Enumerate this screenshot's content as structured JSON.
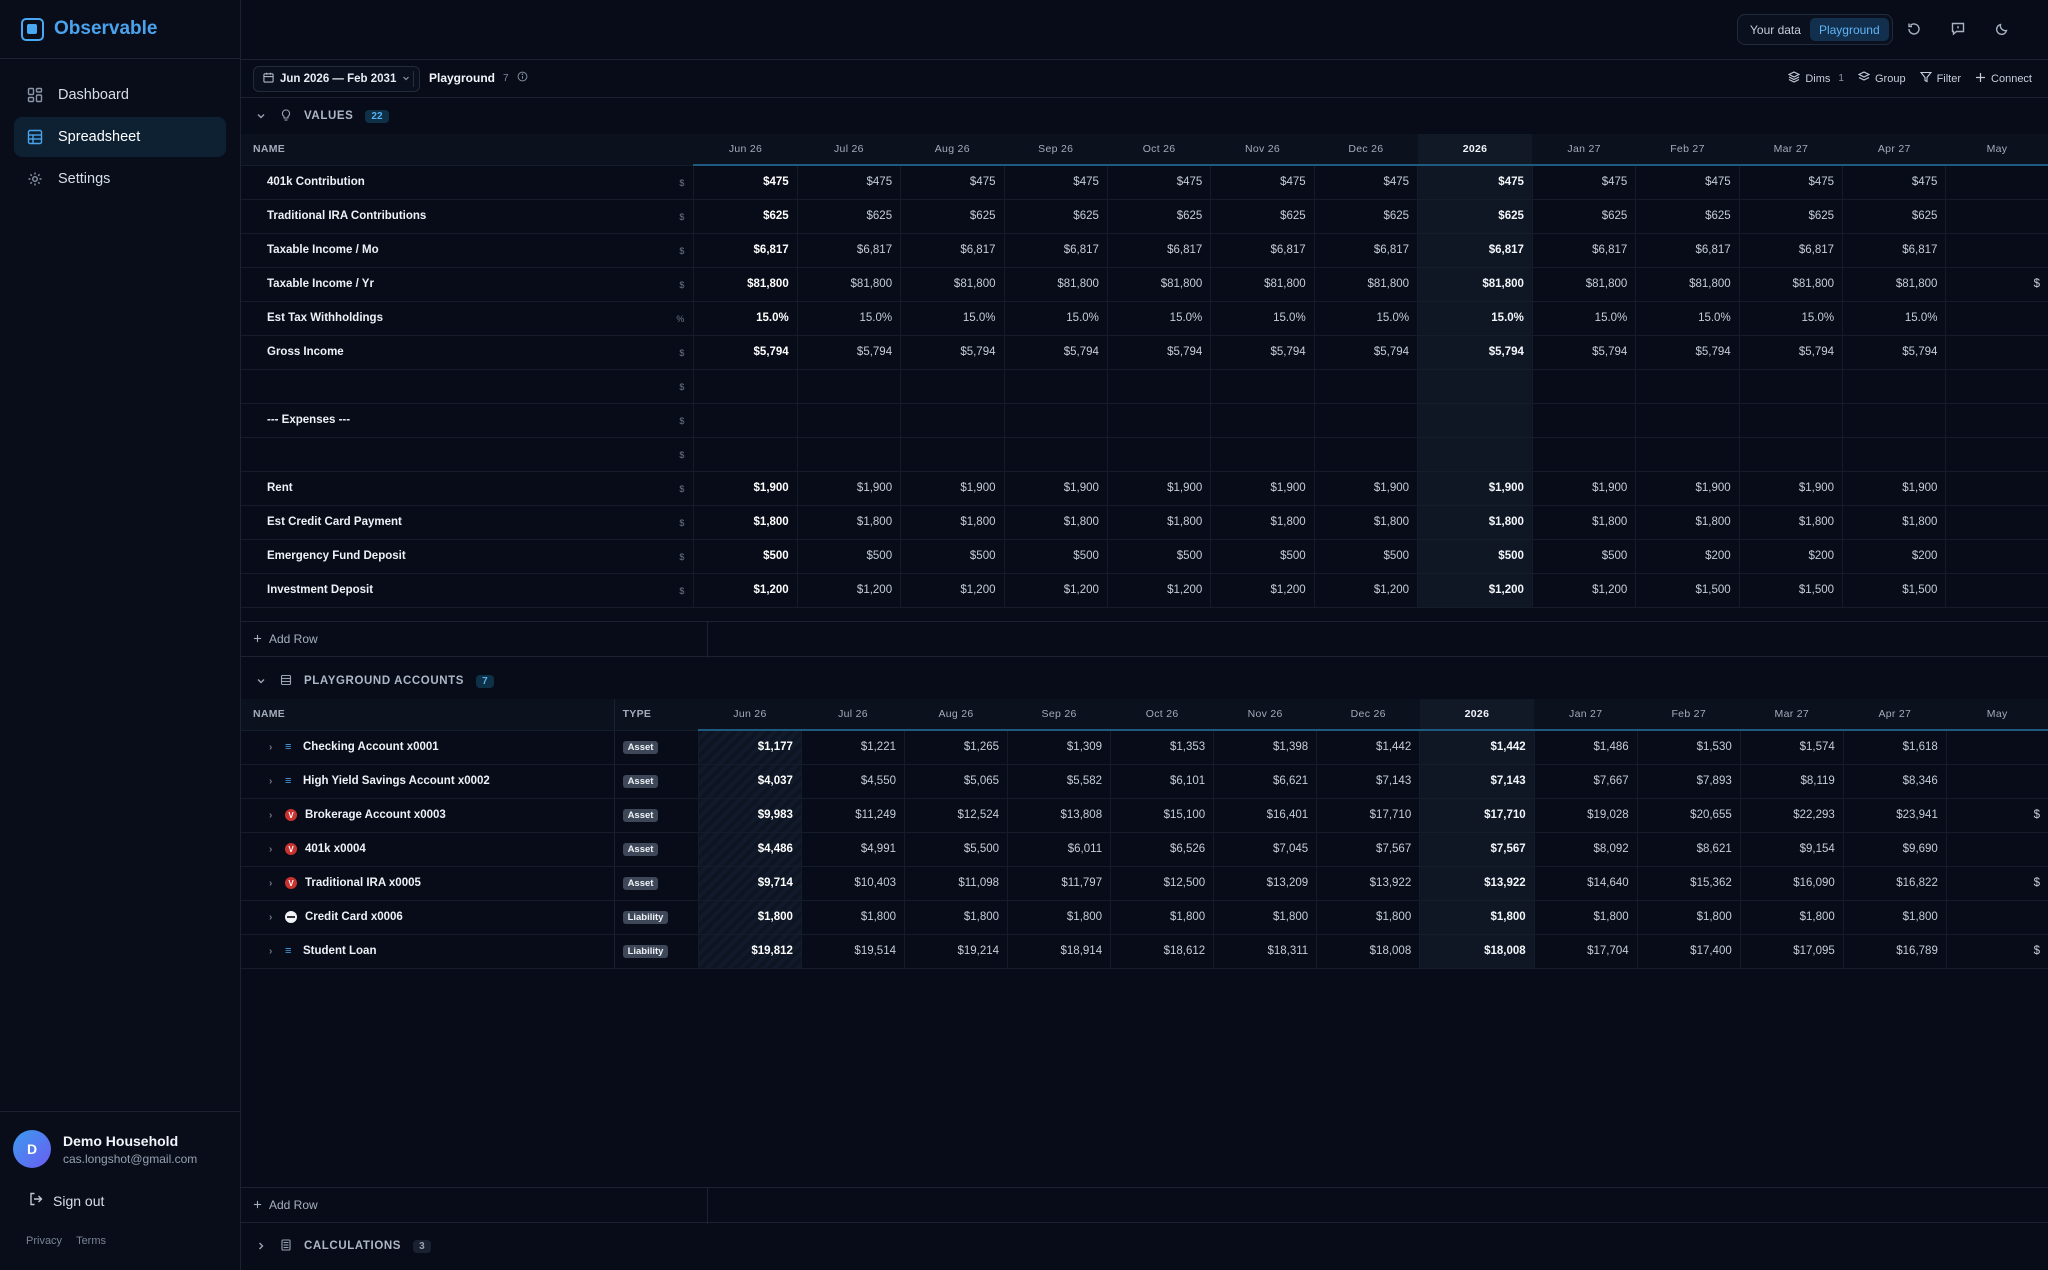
{
  "app": {
    "name": "Observable"
  },
  "nav": [
    {
      "label": "Dashboard",
      "icon": "dashboard-icon",
      "active": false
    },
    {
      "label": "Spreadsheet",
      "icon": "spreadsheet-icon",
      "active": true
    },
    {
      "label": "Settings",
      "icon": "gear-icon",
      "active": false
    }
  ],
  "user": {
    "initial": "D",
    "name": "Demo Household",
    "email": "cas.longshot@gmail.com"
  },
  "signout_label": "Sign out",
  "legal": {
    "privacy": "Privacy",
    "terms": "Terms"
  },
  "topbar": {
    "your_data": "Your data",
    "playground": "Playground"
  },
  "toolbar": {
    "date_range": "Jun 2026 — Feb 2031",
    "playground": "Playground",
    "playground_count": "7",
    "dims": "Dims",
    "dims_count": "1",
    "group": "Group",
    "filter": "Filter",
    "connect": "Connect"
  },
  "months": [
    "Jun 26",
    "Jul 26",
    "Aug 26",
    "Sep 26",
    "Oct 26",
    "Nov 26",
    "Dec 26",
    "2026",
    "Jan 27",
    "Feb 27",
    "Mar 27",
    "Apr 27",
    "May"
  ],
  "values_section": {
    "title": "VALUES",
    "count": "22",
    "name_header": "NAME",
    "add_row": "Add Row",
    "rows": [
      {
        "name": "401k Contribution",
        "unit": "$",
        "values": [
          "$475",
          "$475",
          "$475",
          "$475",
          "$475",
          "$475",
          "$475",
          "$475",
          "$475",
          "$475",
          "$475",
          "$475",
          ""
        ]
      },
      {
        "name": "Traditional IRA Contributions",
        "unit": "$",
        "values": [
          "$625",
          "$625",
          "$625",
          "$625",
          "$625",
          "$625",
          "$625",
          "$625",
          "$625",
          "$625",
          "$625",
          "$625",
          ""
        ]
      },
      {
        "name": "Taxable Income / Mo",
        "unit": "$",
        "values": [
          "$6,817",
          "$6,817",
          "$6,817",
          "$6,817",
          "$6,817",
          "$6,817",
          "$6,817",
          "$6,817",
          "$6,817",
          "$6,817",
          "$6,817",
          "$6,817",
          ""
        ]
      },
      {
        "name": "Taxable Income / Yr",
        "unit": "$",
        "values": [
          "$81,800",
          "$81,800",
          "$81,800",
          "$81,800",
          "$81,800",
          "$81,800",
          "$81,800",
          "$81,800",
          "$81,800",
          "$81,800",
          "$81,800",
          "$81,800",
          "$"
        ]
      },
      {
        "name": "Est Tax Withholdings",
        "unit": "%",
        "values": [
          "15.0%",
          "15.0%",
          "15.0%",
          "15.0%",
          "15.0%",
          "15.0%",
          "15.0%",
          "15.0%",
          "15.0%",
          "15.0%",
          "15.0%",
          "15.0%",
          ""
        ]
      },
      {
        "name": "Gross Income",
        "unit": "$",
        "values": [
          "$5,794",
          "$5,794",
          "$5,794",
          "$5,794",
          "$5,794",
          "$5,794",
          "$5,794",
          "$5,794",
          "$5,794",
          "$5,794",
          "$5,794",
          "$5,794",
          ""
        ]
      },
      {
        "name": "",
        "unit": "$",
        "values": [
          "",
          "",
          "",
          "",
          "",
          "",
          "",
          "",
          "",
          "",
          "",
          "",
          ""
        ]
      },
      {
        "name": "--- Expenses ---",
        "unit": "$",
        "values": [
          "",
          "",
          "",
          "",
          "",
          "",
          "",
          "",
          "",
          "",
          "",
          "",
          ""
        ]
      },
      {
        "name": "",
        "unit": "$",
        "values": [
          "",
          "",
          "",
          "",
          "",
          "",
          "",
          "",
          "",
          "",
          "",
          "",
          ""
        ]
      },
      {
        "name": "Rent",
        "unit": "$",
        "values": [
          "$1,900",
          "$1,900",
          "$1,900",
          "$1,900",
          "$1,900",
          "$1,900",
          "$1,900",
          "$1,900",
          "$1,900",
          "$1,900",
          "$1,900",
          "$1,900",
          ""
        ]
      },
      {
        "name": "Est Credit Card Payment",
        "unit": "$",
        "values": [
          "$1,800",
          "$1,800",
          "$1,800",
          "$1,800",
          "$1,800",
          "$1,800",
          "$1,800",
          "$1,800",
          "$1,800",
          "$1,800",
          "$1,800",
          "$1,800",
          ""
        ]
      },
      {
        "name": "Emergency Fund Deposit",
        "unit": "$",
        "values": [
          "$500",
          "$500",
          "$500",
          "$500",
          "$500",
          "$500",
          "$500",
          "$500",
          "$500",
          "$200",
          "$200",
          "$200",
          ""
        ]
      },
      {
        "name": "Investment Deposit",
        "unit": "$",
        "values": [
          "$1,200",
          "$1,200",
          "$1,200",
          "$1,200",
          "$1,200",
          "$1,200",
          "$1,200",
          "$1,200",
          "$1,200",
          "$1,500",
          "$1,500",
          "$1,500",
          ""
        ]
      }
    ]
  },
  "accounts_section": {
    "title": "PLAYGROUND ACCOUNTS",
    "count": "7",
    "name_header": "NAME",
    "type_header": "TYPE",
    "add_row": "Add Row",
    "rows": [
      {
        "name": "Checking Account x0001",
        "icon": "lines",
        "type": "Asset",
        "values": [
          "$1,177",
          "$1,221",
          "$1,265",
          "$1,309",
          "$1,353",
          "$1,398",
          "$1,442",
          "$1,442",
          "$1,486",
          "$1,530",
          "$1,574",
          "$1,618",
          ""
        ]
      },
      {
        "name": "High Yield Savings Account x0002",
        "icon": "lines",
        "type": "Asset",
        "values": [
          "$4,037",
          "$4,550",
          "$5,065",
          "$5,582",
          "$6,101",
          "$6,621",
          "$7,143",
          "$7,143",
          "$7,667",
          "$7,893",
          "$8,119",
          "$8,346",
          ""
        ]
      },
      {
        "name": "Brokerage Account x0003",
        "icon": "v",
        "type": "Asset",
        "values": [
          "$9,983",
          "$11,249",
          "$12,524",
          "$13,808",
          "$15,100",
          "$16,401",
          "$17,710",
          "$17,710",
          "$19,028",
          "$20,655",
          "$22,293",
          "$23,941",
          "$"
        ]
      },
      {
        "name": "401k x0004",
        "icon": "v",
        "type": "Asset",
        "values": [
          "$4,486",
          "$4,991",
          "$5,500",
          "$6,011",
          "$6,526",
          "$7,045",
          "$7,567",
          "$7,567",
          "$8,092",
          "$8,621",
          "$9,154",
          "$9,690",
          ""
        ]
      },
      {
        "name": "Traditional IRA x0005",
        "icon": "v",
        "type": "Asset",
        "values": [
          "$9,714",
          "$10,403",
          "$11,098",
          "$11,797",
          "$12,500",
          "$13,209",
          "$13,922",
          "$13,922",
          "$14,640",
          "$15,362",
          "$16,090",
          "$16,822",
          "$"
        ]
      },
      {
        "name": "Credit Card x0006",
        "icon": "cc",
        "type": "Liability",
        "values": [
          "$1,800",
          "$1,800",
          "$1,800",
          "$1,800",
          "$1,800",
          "$1,800",
          "$1,800",
          "$1,800",
          "$1,800",
          "$1,800",
          "$1,800",
          "$1,800",
          ""
        ]
      },
      {
        "name": "Student Loan",
        "icon": "lines",
        "type": "Liability",
        "values": [
          "$19,812",
          "$19,514",
          "$19,214",
          "$18,914",
          "$18,612",
          "$18,311",
          "$18,008",
          "$18,008",
          "$17,704",
          "$17,400",
          "$17,095",
          "$16,789",
          "$"
        ]
      }
    ]
  },
  "calculations_section": {
    "title": "CALCULATIONS",
    "count": "3"
  }
}
